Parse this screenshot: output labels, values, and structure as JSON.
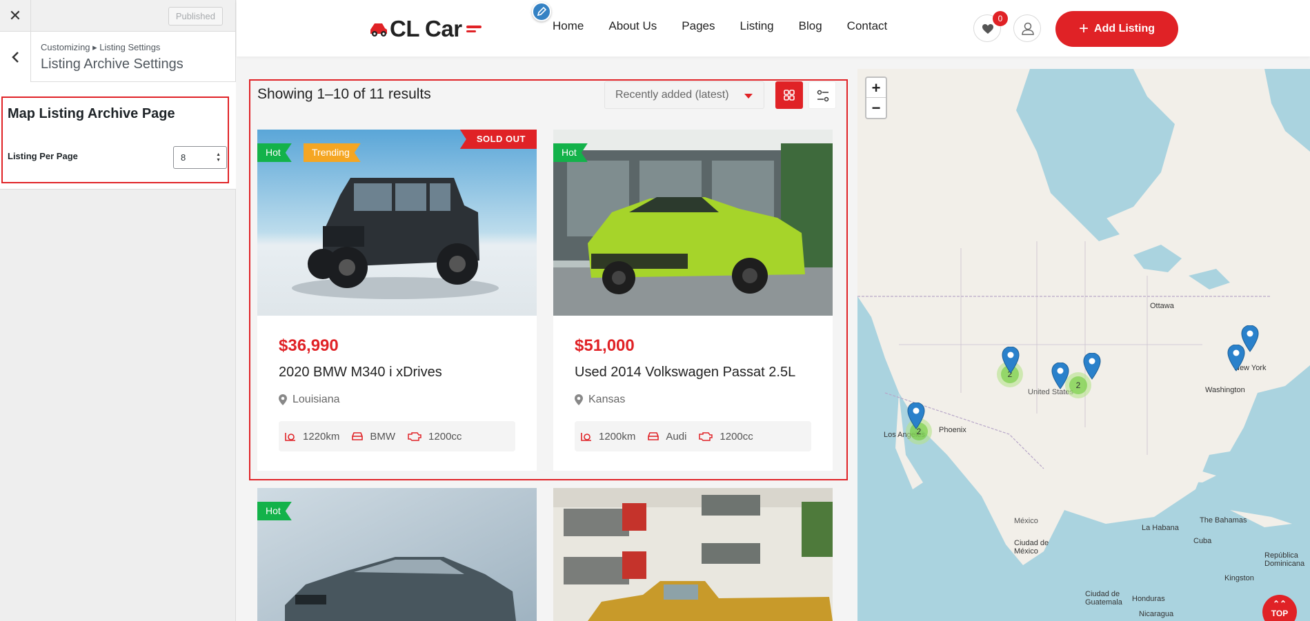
{
  "customizer": {
    "close_icon": "close-icon",
    "published_label": "Published",
    "back_icon": "chevron-left-icon",
    "breadcrumb": "Customizing ▸ Listing Settings",
    "panel_title": "Listing Archive Settings",
    "section_title": "Map Listing Archive Page",
    "field_label": "Listing Per Page",
    "field_value": "8"
  },
  "header": {
    "logo_text": "CL Car",
    "nav": [
      "Home",
      "About Us",
      "Pages",
      "Listing",
      "Blog",
      "Contact"
    ],
    "favorites_count": "0",
    "add_listing_label": "Add Listing",
    "brand_color": "#e02226"
  },
  "results": {
    "count_text": "Showing 1–10 of 11 results",
    "sort_selected": "Recently added (latest)"
  },
  "listings": [
    {
      "badges": [
        "Hot",
        "Trending"
      ],
      "status": "SOLD OUT",
      "price": "$36,990",
      "title": "2020 BMW M340 i xDrives",
      "location": "Louisiana",
      "mileage": "1220km",
      "make": "BMW",
      "engine": "1200cc"
    },
    {
      "badges": [
        "Hot"
      ],
      "status": "",
      "price": "$51,000",
      "title": "Used 2014 Volkswagen Passat 2.5L",
      "location": "Kansas",
      "mileage": "1200km",
      "make": "Audi",
      "engine": "1200cc"
    },
    {
      "badges": [
        "Hot"
      ]
    },
    {
      "badges": []
    }
  ],
  "map": {
    "zoom_in": "+",
    "zoom_out": "−",
    "labels": {
      "ottawa": "Ottawa",
      "new_york": "New York",
      "washington": "Washington",
      "united_states": "United States",
      "phoenix": "Phoenix",
      "los_angeles": "Los Angeles",
      "mexico": "México",
      "ciudad_de_mexico": "Ciudad de México",
      "la_habana": "La Habana",
      "the_bahamas": "The Bahamas",
      "cuba": "Cuba",
      "republica_dominicana": "República Dominicana",
      "kingston": "Kingston",
      "ciudad_de_guatemala": "Ciudad de Guatemala",
      "honduras": "Honduras",
      "nicaragua": "Nicaragua"
    },
    "clusters": [
      "2",
      "2",
      "2"
    ]
  },
  "back_to_top_label": "TOP"
}
